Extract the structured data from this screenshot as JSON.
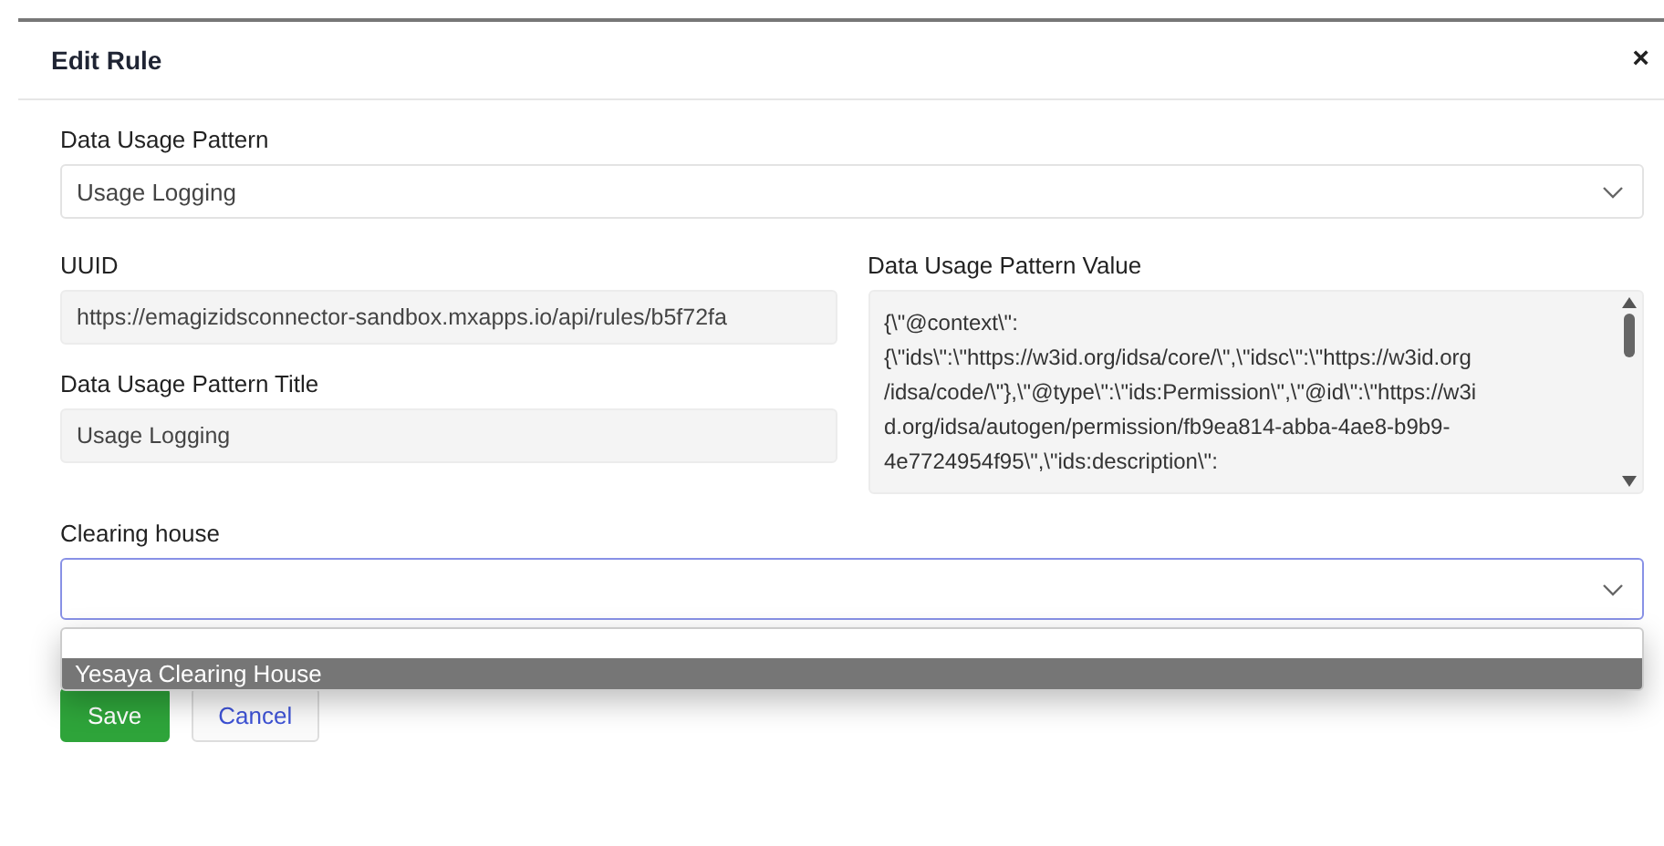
{
  "dialog": {
    "title": "Edit Rule",
    "close": "×"
  },
  "pattern": {
    "label": "Data Usage Pattern",
    "value": "Usage Logging"
  },
  "uuid": {
    "label": "UUID",
    "value": "https://emagizidsconnector-sandbox.mxapps.io/api/rules/b5f72fa"
  },
  "pattern_title": {
    "label": "Data Usage Pattern Title",
    "value": "Usage Logging"
  },
  "pattern_value": {
    "label": "Data Usage Pattern Value",
    "value_lines": [
      "{\\\"@context\\\":",
      "{\\\"ids\\\":\\\"https://w3id.org/idsa/core/\\\",\\\"idsc\\\":\\\"https://w3id.org",
      "/idsa/code/\\\"},\\\"@type\\\":\\\"ids:Permission\\\",\\\"@id\\\":\\\"https://w3i",
      "d.org/idsa/autogen/permission/fb9ea814-abba-4ae8-b9b9-",
      "4e7724954f95\\\",\\\"ids:description\\\":"
    ]
  },
  "clearing_house": {
    "label": "Clearing house",
    "open": true,
    "options": [
      {
        "label": "Yesaya Clearing House",
        "selected": true
      }
    ]
  },
  "buttons": [
    {
      "kind": "primary",
      "label": "Save"
    },
    {
      "kind": "secondary",
      "label": "Cancel"
    }
  ]
}
